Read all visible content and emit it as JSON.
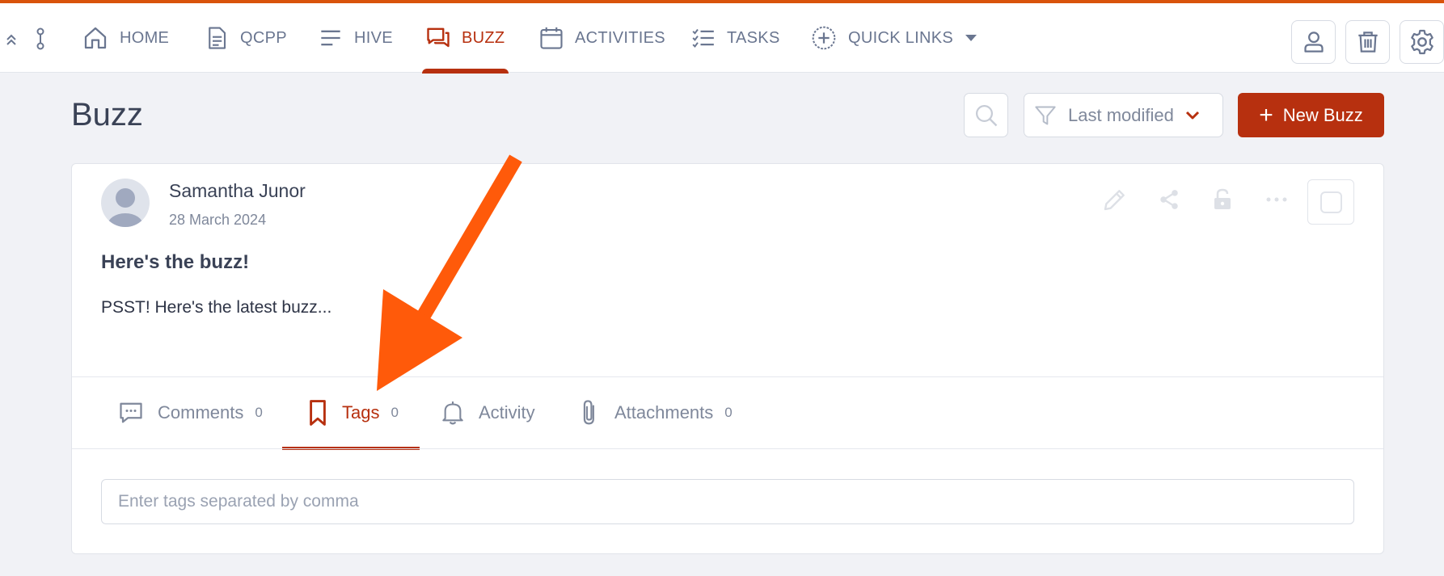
{
  "nav": {
    "items": [
      {
        "label": "HOME",
        "icon": "home-icon"
      },
      {
        "label": "QCPP",
        "icon": "document-icon"
      },
      {
        "label": "HIVE",
        "icon": "lines-icon"
      },
      {
        "label": "BUZZ",
        "icon": "chat-icon",
        "active": true
      },
      {
        "label": "ACTIVITIES",
        "icon": "calendar-icon"
      },
      {
        "label": "TASKS",
        "icon": "checklist-icon"
      },
      {
        "label": "QUICK LINKS",
        "icon": "plus-circle-icon"
      }
    ],
    "tools": [
      "user-icon",
      "trash-icon",
      "gear-icon"
    ]
  },
  "page": {
    "title": "Buzz",
    "sort_label": "Last modified",
    "new_button_label": "New Buzz"
  },
  "post": {
    "author": "Samantha Junor",
    "date": "28 March 2024",
    "title": "Here's the buzz!",
    "body": "PSST! Here's the latest buzz..."
  },
  "tabs": [
    {
      "label": "Comments",
      "count": "0"
    },
    {
      "label": "Tags",
      "count": "0",
      "active": true
    },
    {
      "label": "Activity",
      "count": null
    },
    {
      "label": "Attachments",
      "count": "0"
    }
  ],
  "tags_input": {
    "placeholder": "Enter tags separated by comma",
    "value": ""
  },
  "colors": {
    "accent": "#b7300f",
    "top_border": "#d9530b",
    "annotation_arrow": "#ff5a0a",
    "background": "#f1f2f6"
  }
}
